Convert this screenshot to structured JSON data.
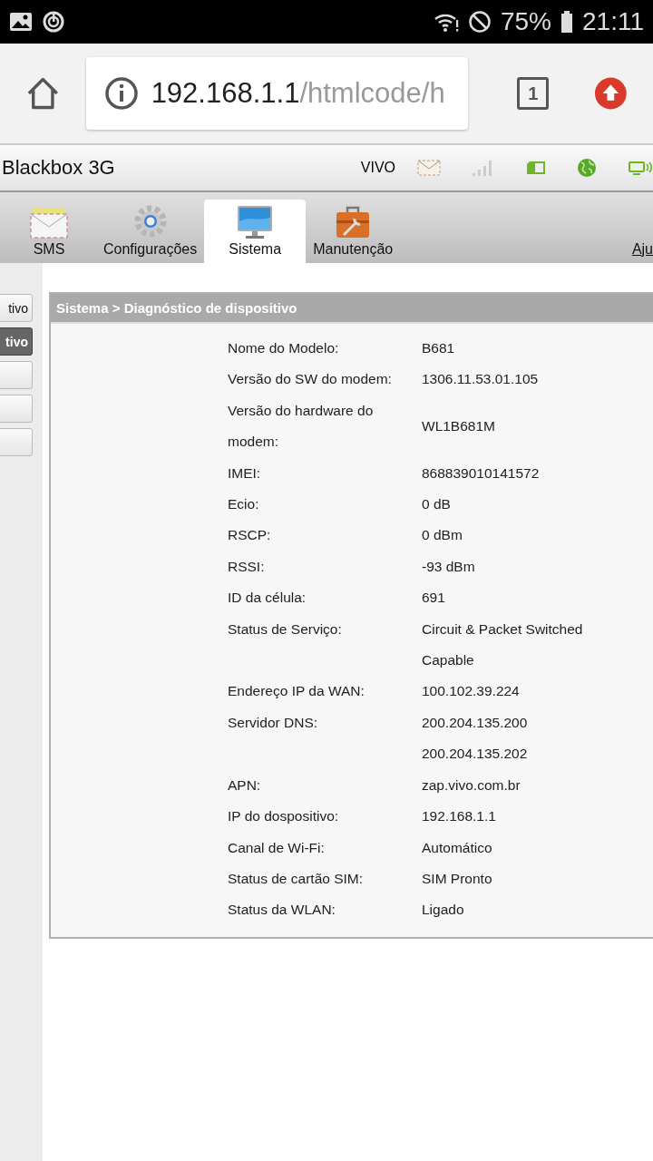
{
  "status_bar": {
    "battery": "75%",
    "time": "21:11"
  },
  "browser": {
    "url_host": "192.168.1.1",
    "url_path": "/htmlcode/h",
    "tab_count": "1"
  },
  "header": {
    "title": "Blackbox 3G",
    "carrier": "VIVO"
  },
  "tabs": [
    {
      "label": "SMS",
      "kind": "envelope",
      "selected": false
    },
    {
      "label": "Configurações",
      "kind": "gear",
      "selected": false
    },
    {
      "label": "Sistema",
      "kind": "monitor",
      "selected": true
    },
    {
      "label": "Manutenção",
      "kind": "toolbox",
      "selected": false
    }
  ],
  "help_link": "Aju",
  "sidebar": {
    "items": [
      {
        "label": "tivo",
        "selected": false
      },
      {
        "label": "tivo",
        "selected": true
      },
      {
        "selected": false
      },
      {
        "selected": false
      },
      {
        "selected": false
      }
    ]
  },
  "panel": {
    "title": "Sistema > Diagnóstico de dispositivo",
    "rows": [
      {
        "label": "Nome do Modelo:",
        "values": [
          "B681"
        ]
      },
      {
        "label": "Versão do SW do modem:",
        "values": [
          "1306.11.53.01.105"
        ]
      },
      {
        "label": "Versão do hardware do modem:",
        "values": [
          "WL1B681M"
        ]
      },
      {
        "label": "IMEI:",
        "values": [
          "868839010141572"
        ]
      },
      {
        "label": "Ecio:",
        "values": [
          "0 dB"
        ]
      },
      {
        "label": "RSCP:",
        "values": [
          "0 dBm"
        ]
      },
      {
        "label": "RSSI:",
        "values": [
          "-93 dBm"
        ]
      },
      {
        "label": "ID da célula:",
        "values": [
          "691"
        ]
      },
      {
        "label": "Status de Serviço:",
        "values": [
          "Circuit & Packet Switched Capable"
        ]
      },
      {
        "label": "Endereço IP da WAN:",
        "values": [
          "100.102.39.224"
        ]
      },
      {
        "label": "Servidor DNS:",
        "values": [
          "200.204.135.200",
          "200.204.135.202"
        ]
      },
      {
        "label": "APN:",
        "values": [
          "zap.vivo.com.br"
        ]
      },
      {
        "label": "IP do dospositivo:",
        "values": [
          "192.168.1.1"
        ]
      },
      {
        "label": "Canal de Wi-Fi:",
        "values": [
          "Automático"
        ]
      },
      {
        "label": "Status de cartão SIM:",
        "values": [
          "SIM Pronto"
        ]
      },
      {
        "label": "Status da WLAN:",
        "values": [
          "Ligado"
        ]
      }
    ]
  }
}
